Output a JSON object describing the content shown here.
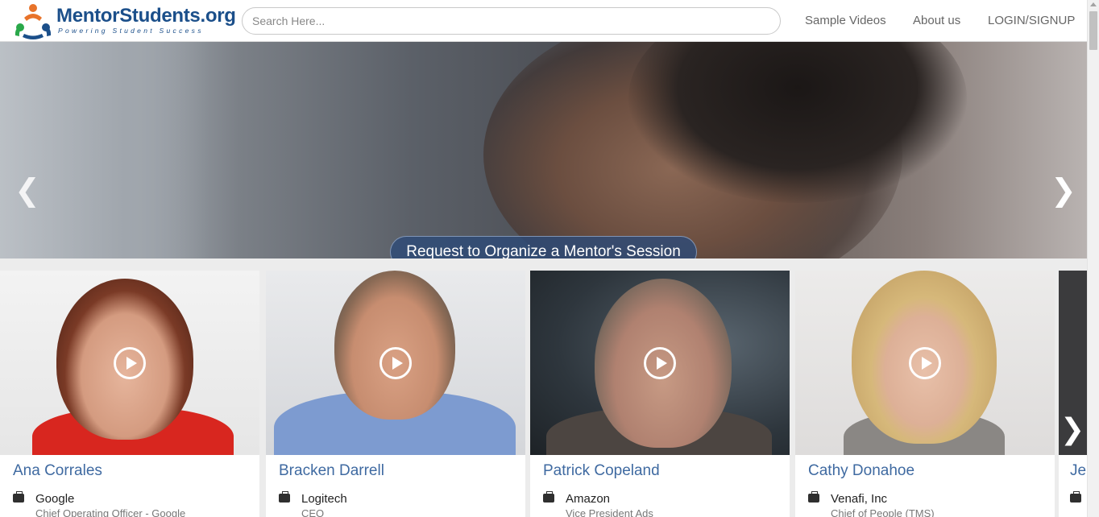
{
  "header": {
    "logo_title": "MentorStudents.org",
    "logo_tagline": "Powering Student Success",
    "search_placeholder": "Search Here...",
    "nav": {
      "sample_videos": "Sample Videos",
      "about_us": "About us",
      "login_signup": "LOGIN/SIGNUP"
    }
  },
  "hero": {
    "cta_label": "Request to Organize a Mentor's Session",
    "prev_icon": "chevron-left-icon",
    "next_icon": "chevron-right-icon"
  },
  "mentors": [
    {
      "name": "Ana Corrales",
      "company": "Google",
      "role": "Chief Operating Officer - Google"
    },
    {
      "name": "Bracken Darrell",
      "company": "Logitech",
      "role": "CEO"
    },
    {
      "name": "Patrick Copeland",
      "company": "Amazon",
      "role": "Vice President Ads"
    },
    {
      "name": "Cathy Donahoe",
      "company": "Venafi, Inc",
      "role": "Chief of People (TMS)"
    },
    {
      "name": "Je"
    }
  ],
  "colors": {
    "brand_blue": "#1b4f8a",
    "link_blue": "#3f6aa1",
    "cta_bg": "#2d4b78"
  }
}
